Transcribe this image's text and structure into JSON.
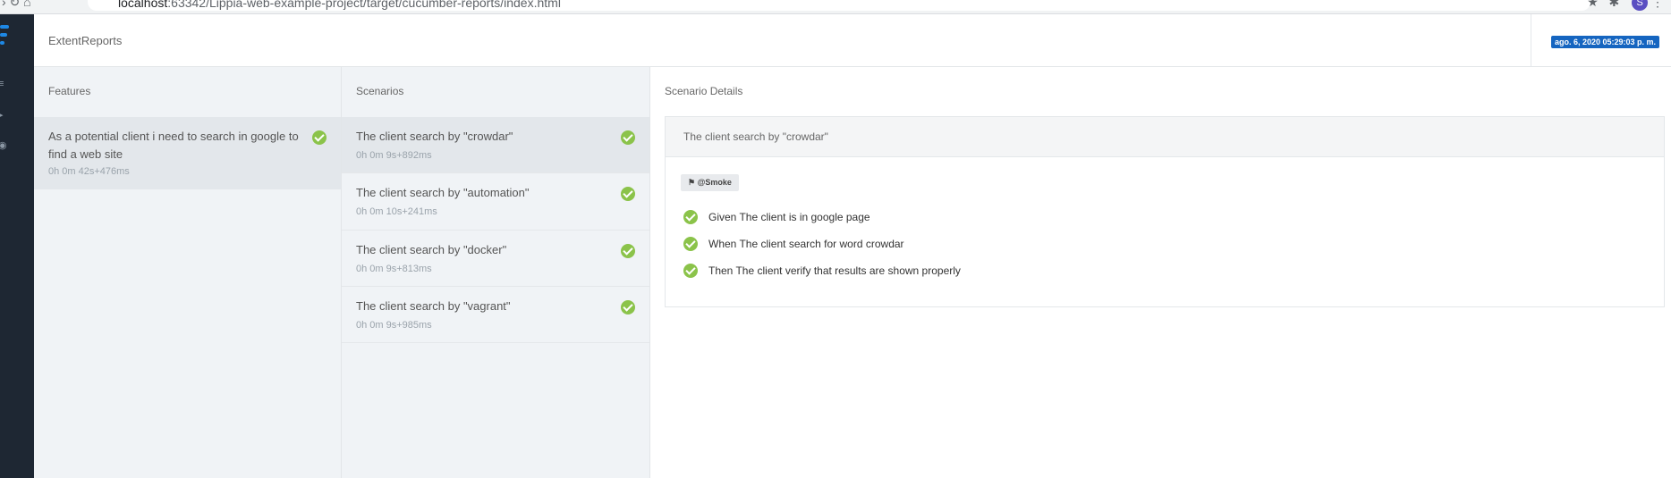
{
  "browser": {
    "url_host": "localhost",
    "url_rest": ":63342/Lippia-web-example-project/target/cucumber-reports/index.html",
    "profile_initial": "S"
  },
  "header": {
    "brand": "ExtentReports",
    "date": "ago. 6, 2020 05:29:03 p. m."
  },
  "features": {
    "title": "Features",
    "items": [
      {
        "name": "As a potential client i need to search in google to find a web site",
        "duration": "0h 0m 42s+476ms",
        "status": "pass"
      }
    ]
  },
  "scenarios": {
    "title": "Scenarios",
    "items": [
      {
        "name": "The client search by \"crowdar\"",
        "duration": "0h 0m 9s+892ms",
        "status": "pass"
      },
      {
        "name": "The client search by \"automation\"",
        "duration": "0h 0m 10s+241ms",
        "status": "pass"
      },
      {
        "name": "The client search by \"docker\"",
        "duration": "0h 0m 9s+813ms",
        "status": "pass"
      },
      {
        "name": "The client search by \"vagrant\"",
        "duration": "0h 0m 9s+985ms",
        "status": "pass"
      }
    ]
  },
  "details": {
    "title": "Scenario Details",
    "scenario_name": "The client search by \"crowdar\"",
    "tag": "@Smoke",
    "steps": [
      {
        "text": "Given The client is in google page",
        "status": "pass"
      },
      {
        "text": "When The client search for word crowdar",
        "status": "pass"
      },
      {
        "text": "Then The client verify that results are shown properly",
        "status": "pass"
      }
    ]
  },
  "colors": {
    "pass": "#8bc34a",
    "nav_bg": "#1e2733",
    "date_badge": "#1565c0"
  }
}
